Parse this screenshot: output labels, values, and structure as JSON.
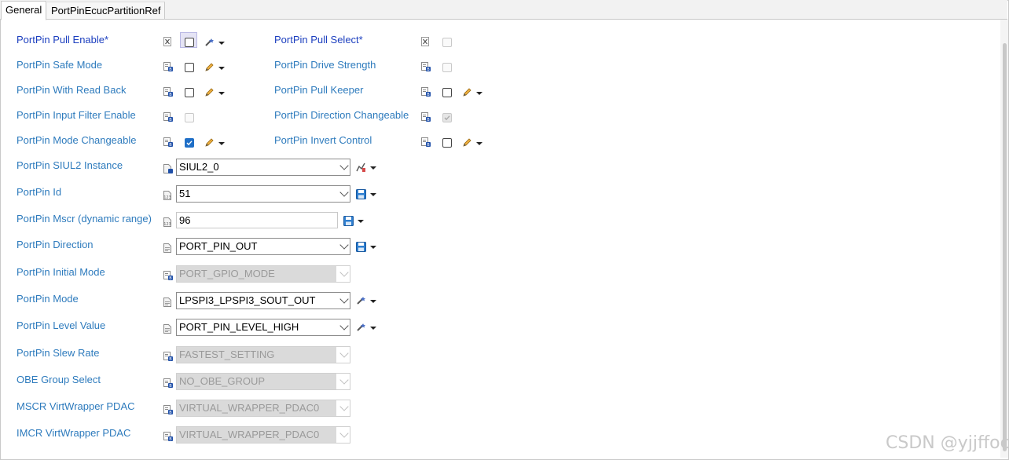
{
  "tabs": [
    {
      "label": "General",
      "active": true
    },
    {
      "label": "PortPinEcucPartitionRef",
      "active": false
    }
  ],
  "left_checkbox_rows": [
    {
      "label": "PortPin Pull Enable*",
      "checked": false,
      "enabled": true,
      "tool": "wand"
    },
    {
      "label": "PortPin Safe Mode",
      "checked": false,
      "enabled": true,
      "tool": "pencil"
    },
    {
      "label": "PortPin With Read Back",
      "checked": false,
      "enabled": true,
      "tool": "pencil"
    },
    {
      "label": "PortPin Input Filter Enable",
      "checked": false,
      "enabled": false,
      "tool": ""
    },
    {
      "label": "PortPin Mode Changeable",
      "checked": true,
      "enabled": true,
      "tool": "pencil"
    }
  ],
  "right_checkbox_rows": [
    {
      "label": "PortPin Pull Select*",
      "checked": false,
      "enabled": false,
      "tool": ""
    },
    {
      "label": "PortPin Drive Strength",
      "checked": false,
      "enabled": false,
      "tool": ""
    },
    {
      "label": "PortPin Pull Keeper",
      "checked": false,
      "enabled": true,
      "tool": "pencil"
    },
    {
      "label": "PortPin Direction Changeable",
      "checked": true,
      "enabled": false,
      "tool": ""
    },
    {
      "label": "PortPin Invert Control",
      "checked": false,
      "enabled": true,
      "tool": "pencil"
    }
  ],
  "field_rows": [
    {
      "label": "PortPin SIUL2 Instance",
      "value": "SIUL2_0",
      "kind": "combo",
      "enabled": true,
      "tool": "wand-chart"
    },
    {
      "label": "PortPin Id",
      "value": "51",
      "kind": "combo",
      "enabled": true,
      "tool": "save"
    },
    {
      "label": "PortPin Mscr (dynamic range)",
      "value": "96",
      "kind": "text",
      "enabled": true,
      "tool": "save"
    },
    {
      "label": "PortPin Direction",
      "value": "PORT_PIN_OUT",
      "kind": "combo",
      "enabled": true,
      "tool": "save"
    },
    {
      "label": "PortPin Initial Mode",
      "value": "PORT_GPIO_MODE",
      "kind": "combo",
      "enabled": false,
      "tool": ""
    },
    {
      "label": "PortPin Mode",
      "value": "LPSPI3_LPSPI3_SOUT_OUT",
      "kind": "combo",
      "enabled": true,
      "tool": "wand"
    },
    {
      "label": "PortPin Level Value",
      "value": "PORT_PIN_LEVEL_HIGH",
      "kind": "combo",
      "enabled": true,
      "tool": "wand"
    },
    {
      "label": "PortPin Slew Rate",
      "value": "FASTEST_SETTING",
      "kind": "combo",
      "enabled": false,
      "tool": ""
    },
    {
      "label": "OBE Group Select",
      "value": "NO_OBE_GROUP",
      "kind": "combo",
      "enabled": false,
      "tool": ""
    },
    {
      "label": "MSCR VirtWrapper PDAC",
      "value": "VIRTUAL_WRAPPER_PDAC0",
      "kind": "combo",
      "enabled": false,
      "tool": ""
    },
    {
      "label": "IMCR VirtWrapper PDAC",
      "value": "VIRTUAL_WRAPPER_PDAC0",
      "kind": "combo",
      "enabled": false,
      "tool": ""
    }
  ],
  "watermark": "CSDN @yjjffoc",
  "colors": {
    "label": "#2e7bbd",
    "required_label": "#1c3fbf",
    "checkbox_checked": "#1f6fc7"
  }
}
